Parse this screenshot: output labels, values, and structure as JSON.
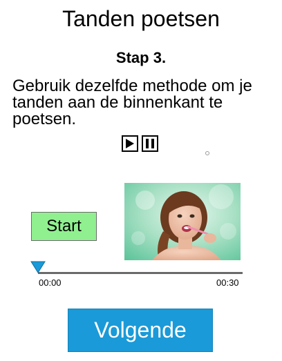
{
  "header": {
    "title": "Tanden poetsen",
    "step": "Stap 3."
  },
  "instruction": {
    "text": "Gebruik dezelfde methode om je tanden aan de binnenkant te poetsen."
  },
  "media_controls": {
    "play_icon": "play-icon",
    "pause_icon": "pause-icon"
  },
  "player": {
    "start_label": "Start",
    "current_time": "00:00",
    "total_time": "00:30",
    "progress": 0
  },
  "footer": {
    "next_label": "Volgende"
  },
  "colors": {
    "start_button": "#90f090",
    "next_button": "#1a9ad8",
    "slider_thumb": "#1a9ad8",
    "track": "#6a6a6a"
  }
}
